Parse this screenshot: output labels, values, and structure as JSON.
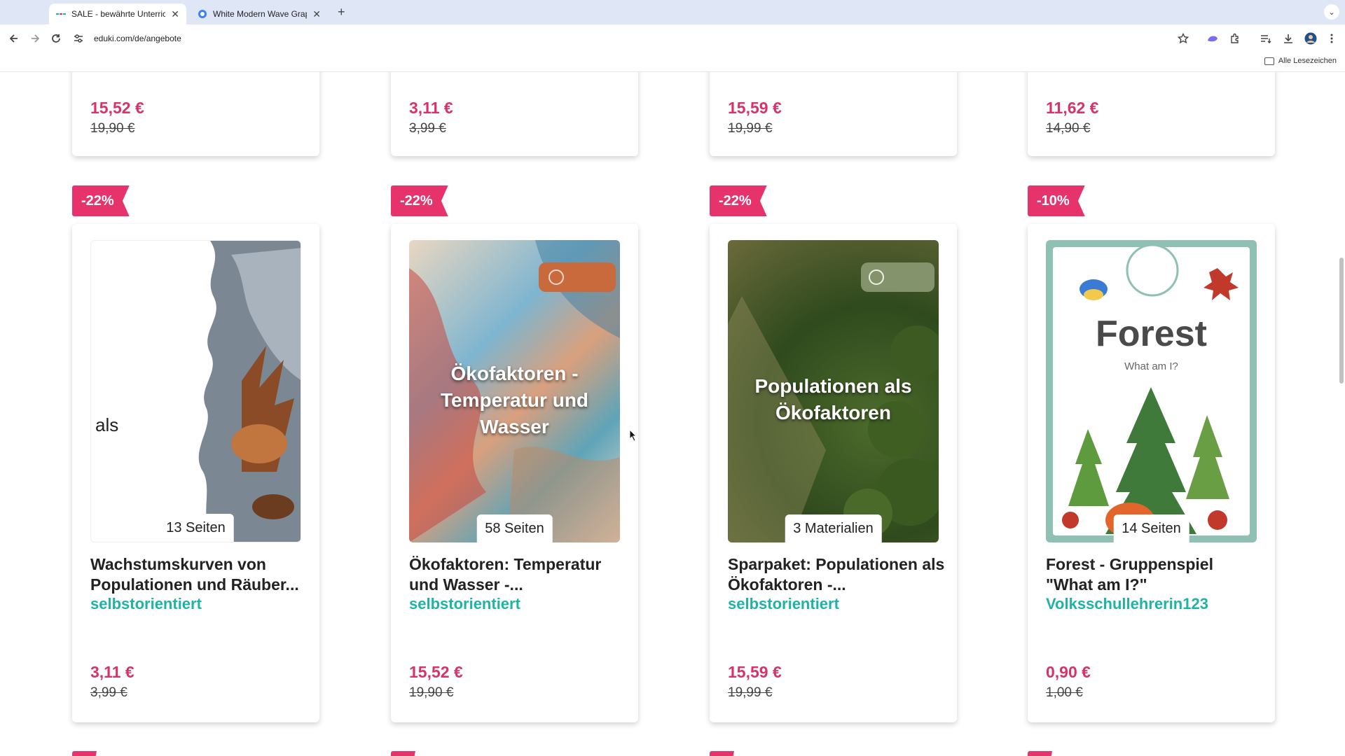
{
  "browser": {
    "tabs": [
      {
        "title": "SALE - bewährte Unterrichtsm",
        "active": true
      },
      {
        "title": "White Modern Wave Graphic",
        "active": false
      }
    ],
    "url": "eduki.com/de/angebote",
    "bookmarks_all": "Alle Lesezeichen"
  },
  "top_row": [
    {
      "price": "15,52 €",
      "old_price": "19,90 €"
    },
    {
      "price": "3,11 €",
      "old_price": "3,99 €"
    },
    {
      "price": "15,59 €",
      "old_price": "19,99 €"
    },
    {
      "price": "11,62 €",
      "old_price": "14,90 €"
    }
  ],
  "products": [
    {
      "discount": "-22%",
      "thumb_text": "als",
      "pages": "13 Seiten",
      "title": "Wachstumskurven von Populationen und Räuber...",
      "author": "selbstorientiert",
      "price": "3,11 €",
      "old_price": "3,99 €"
    },
    {
      "discount": "-22%",
      "thumb_text": "Ökofaktoren - Temperatur und Wasser",
      "pages": "58 Seiten",
      "title": "Ökofaktoren: Temperatur und Wasser -...",
      "author": "selbstorientiert",
      "price": "15,52 €",
      "old_price": "19,90 €"
    },
    {
      "discount": "-22%",
      "thumb_text": "Populationen als Ökofaktoren",
      "pages": "3 Materialien",
      "title": "Sparpaket: Populationen als Ökofaktoren -...",
      "author": "selbstorientiert",
      "price": "15,59 €",
      "old_price": "19,99 €"
    },
    {
      "discount": "-10%",
      "thumb_text": "Forest",
      "thumb_subtext": "What am I?",
      "pages": "14 Seiten",
      "title": "Forest - Gruppenspiel \"What am I?\"",
      "author": "Volksschullehrerin123",
      "price": "0,90 €",
      "old_price": "1,00 €"
    }
  ],
  "colors": {
    "price": "#d6336c",
    "badge": "#e6336c",
    "author": "#20b2a6"
  }
}
